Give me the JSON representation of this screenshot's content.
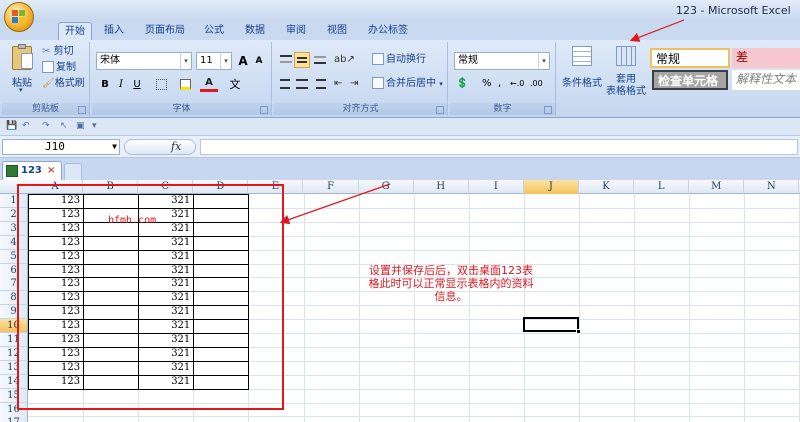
{
  "window": {
    "title": "123 - Microsoft Excel"
  },
  "tabs": [
    "开始",
    "插入",
    "页面布局",
    "公式",
    "数据",
    "审阅",
    "视图",
    "办公标签"
  ],
  "ribbon": {
    "clipboard": {
      "paste": "粘贴",
      "cut": "剪切",
      "copy": "复制",
      "format_painter": "格式刷",
      "label": "剪贴板"
    },
    "font": {
      "name": "宋体",
      "size": "11",
      "bold": "B",
      "italic": "I",
      "underline": "U",
      "grow": "A",
      "shrink": "A",
      "wen": "文",
      "label": "字体"
    },
    "alignment": {
      "wrap_text": "自动换行",
      "merge_center": "合并后居中",
      "label": "对齐方式"
    },
    "number": {
      "format": "常规",
      "label": "数字"
    },
    "styles": {
      "conditional": "条件格式",
      "table_format": "套用\n表格格式",
      "normal": "常规",
      "bad": "差",
      "check_cell": "检查单元格",
      "explanatory": "解释性文本"
    }
  },
  "formula_bar": {
    "name_box": "J10",
    "fx": "fx",
    "formula": ""
  },
  "workbook_tab": {
    "name": "123",
    "close": "×"
  },
  "sheet": {
    "columns": [
      "A",
      "B",
      "C",
      "D",
      "E",
      "F",
      "G",
      "H",
      "I",
      "J",
      "K",
      "L",
      "M",
      "N"
    ],
    "rows": [
      "1",
      "2",
      "3",
      "4",
      "5",
      "6",
      "7",
      "8",
      "9",
      "10",
      "11",
      "12",
      "13",
      "14",
      "15",
      "16",
      "17"
    ],
    "selected_column": "J",
    "selected_row": "10",
    "data": [
      [
        "123",
        "321"
      ],
      [
        "123",
        "321"
      ],
      [
        "123",
        "321"
      ],
      [
        "123",
        "321"
      ],
      [
        "123",
        "321"
      ],
      [
        "123",
        "321"
      ],
      [
        "123",
        "321"
      ],
      [
        "123",
        "321"
      ],
      [
        "123",
        "321"
      ],
      [
        "123",
        "321"
      ],
      [
        "123",
        "321"
      ],
      [
        "123",
        "321"
      ],
      [
        "123",
        "321"
      ],
      [
        "123",
        "321"
      ]
    ]
  },
  "annotations": {
    "watermark": "bfmh.com",
    "note": "设置并保存后后，双击桌面123表格此时可以正常显示表格内的资料信息。",
    "accent_color": "#e0171d"
  }
}
